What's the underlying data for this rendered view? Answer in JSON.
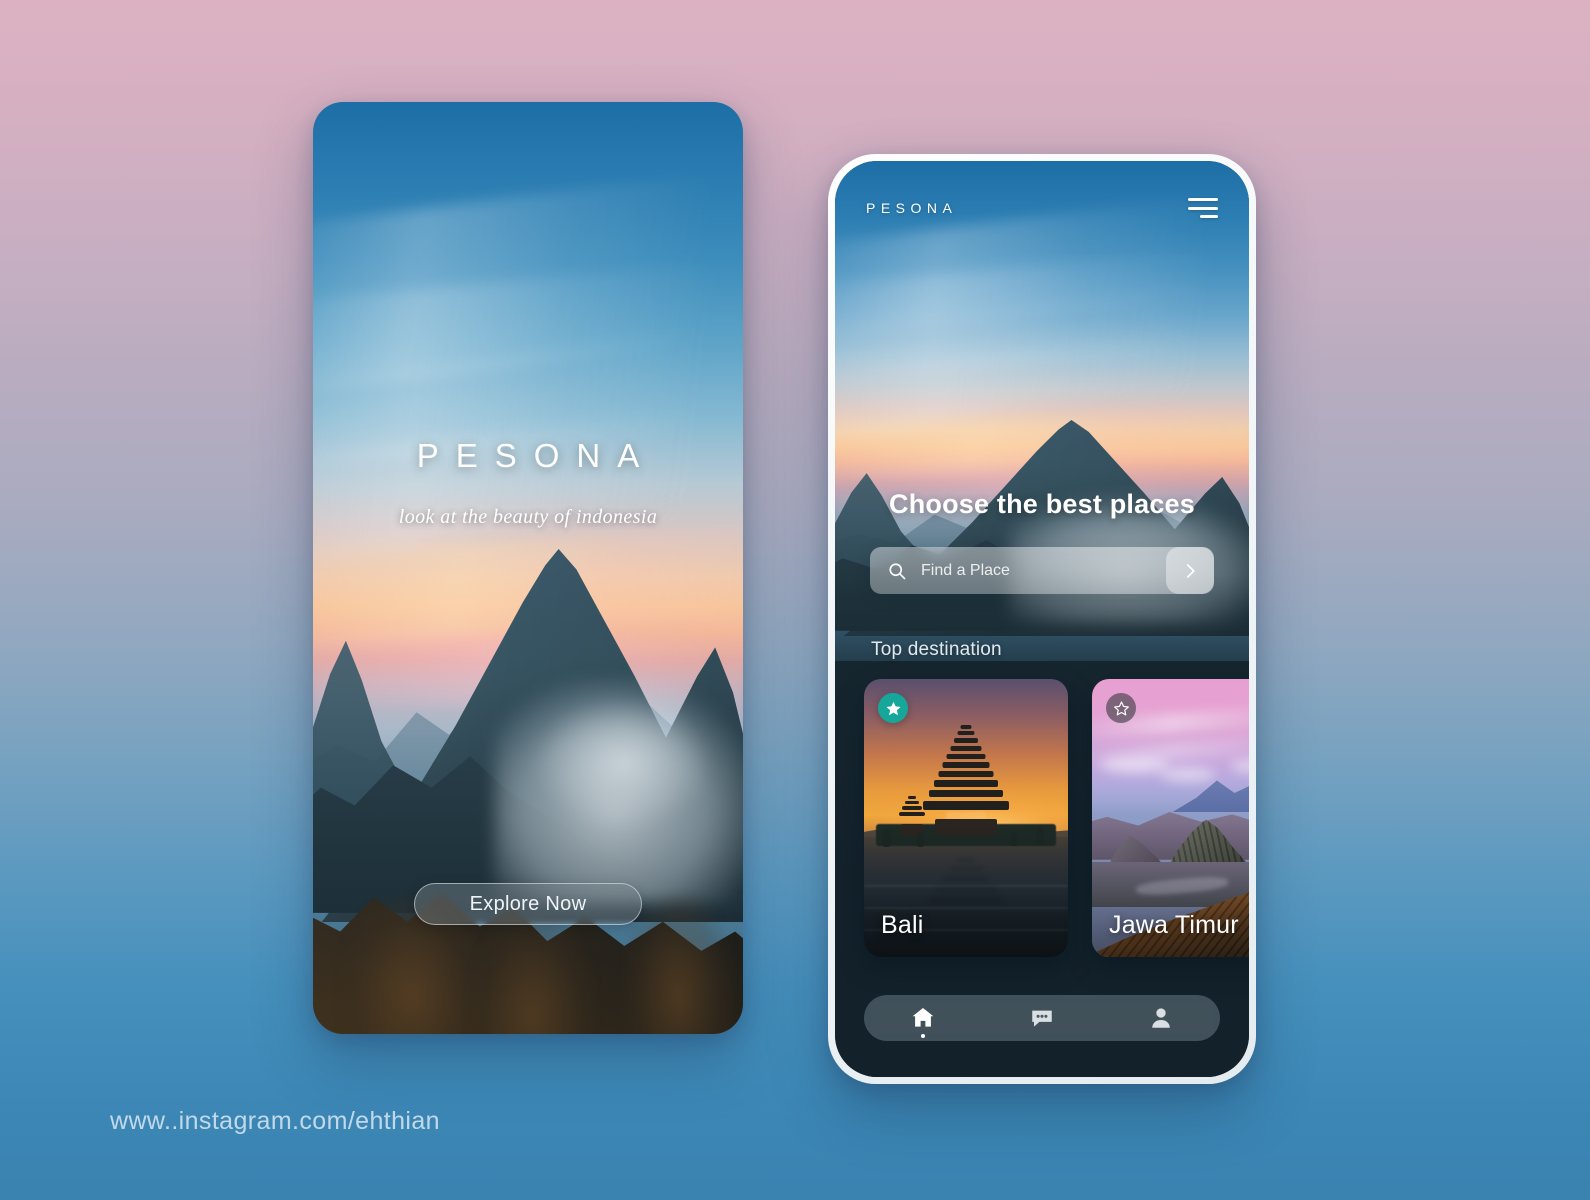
{
  "brand": {
    "name": "PESONA",
    "accent_teal": "#17a79a",
    "background_top": "#dcb2c2",
    "background_bottom": "#3a82b0"
  },
  "splash_screen": {
    "title": "PESONA",
    "tagline": "look at the beauty of indonesia",
    "cta_label": "Explore Now"
  },
  "home_screen": {
    "header": {
      "logo": "PESONA",
      "menu_icon": "hamburger-menu-icon"
    },
    "headline": "Choose the best places",
    "search": {
      "placeholder": "Find a Place",
      "value": "",
      "icon": "search-icon",
      "submit_icon": "chevron-right-icon"
    },
    "section_label": "Top destination",
    "destinations": [
      {
        "name": "Bali",
        "favorited": true,
        "badge_icon": "star-filled-icon",
        "image_alt": "Pura Ulun Danu Beratan temple at sunset"
      },
      {
        "name": "Jawa Timur",
        "favorited": false,
        "badge_icon": "star-outline-icon",
        "image_alt": "Mount Bromo volcanic landscape at dawn"
      }
    ],
    "bottom_nav": [
      {
        "id": "home",
        "icon": "home-icon",
        "active": true
      },
      {
        "id": "chat",
        "icon": "chat-bubble-icon",
        "active": false
      },
      {
        "id": "profile",
        "icon": "person-icon",
        "active": false
      }
    ]
  },
  "watermark": "www..instagram.com/ehthian"
}
